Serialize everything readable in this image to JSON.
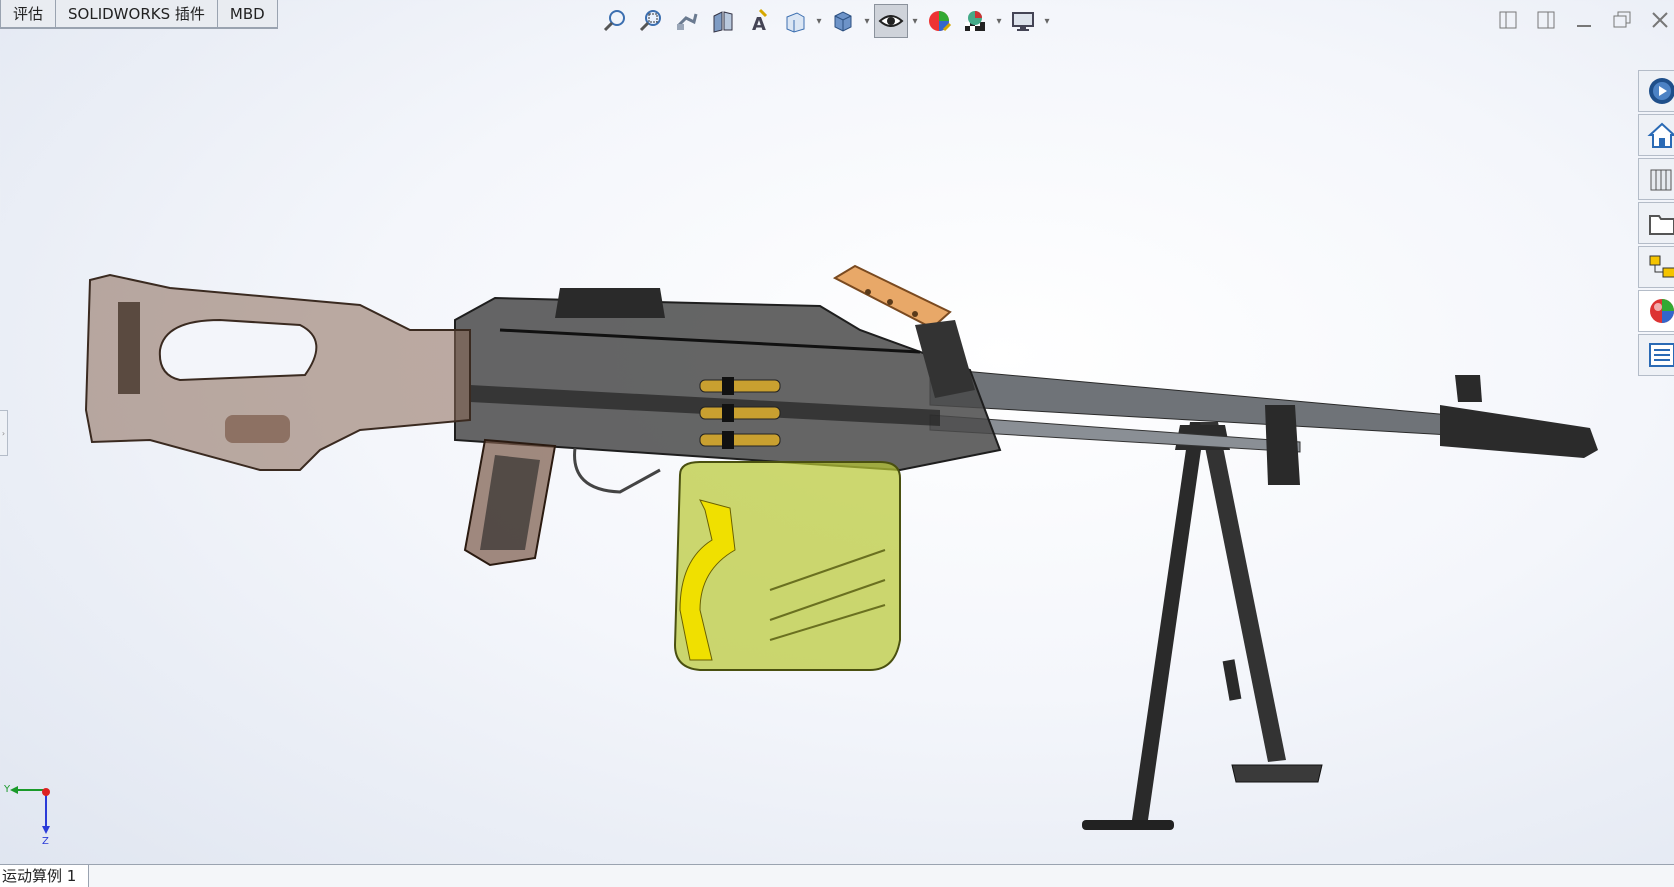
{
  "tabs": [
    "评估",
    "SOLIDWORKS 插件",
    "MBD"
  ],
  "hud_tools": [
    {
      "icon": "zoom-to-fit-icon"
    },
    {
      "icon": "zoom-to-area-icon"
    },
    {
      "icon": "previous-view-icon"
    },
    {
      "icon": "section-view-icon"
    },
    {
      "icon": "dynamic-annotation-icon"
    },
    {
      "icon": "view-orientation-icon"
    },
    {
      "icon": "display-style-icon"
    },
    {
      "icon": "hide-show-items-icon"
    },
    {
      "icon": "edit-appearance-icon"
    },
    {
      "icon": "apply-scene-icon"
    },
    {
      "icon": "view-settings-icon"
    }
  ],
  "task_pane": [
    {
      "icon": "solidworks-resources-icon"
    },
    {
      "icon": "design-library-icon"
    },
    {
      "icon": "file-explorer-icon"
    },
    {
      "icon": "view-palette-icon"
    },
    {
      "icon": "appearances-scenes-icon"
    },
    {
      "icon": "custom-properties-icon"
    },
    {
      "icon": "extra-panel-icon"
    }
  ],
  "triad": {
    "y_label": "Y",
    "z_label": "Z"
  },
  "status_tab": "运动算例 1",
  "colors": {
    "stock": "#8a6a58",
    "receiver": "#3a3a3a",
    "ammo_box": "#b8c832",
    "strap": "#f0e000",
    "handle_wood": "#e8a868",
    "cartridge": "#c9a030",
    "bipod": "#2a2a2a"
  }
}
